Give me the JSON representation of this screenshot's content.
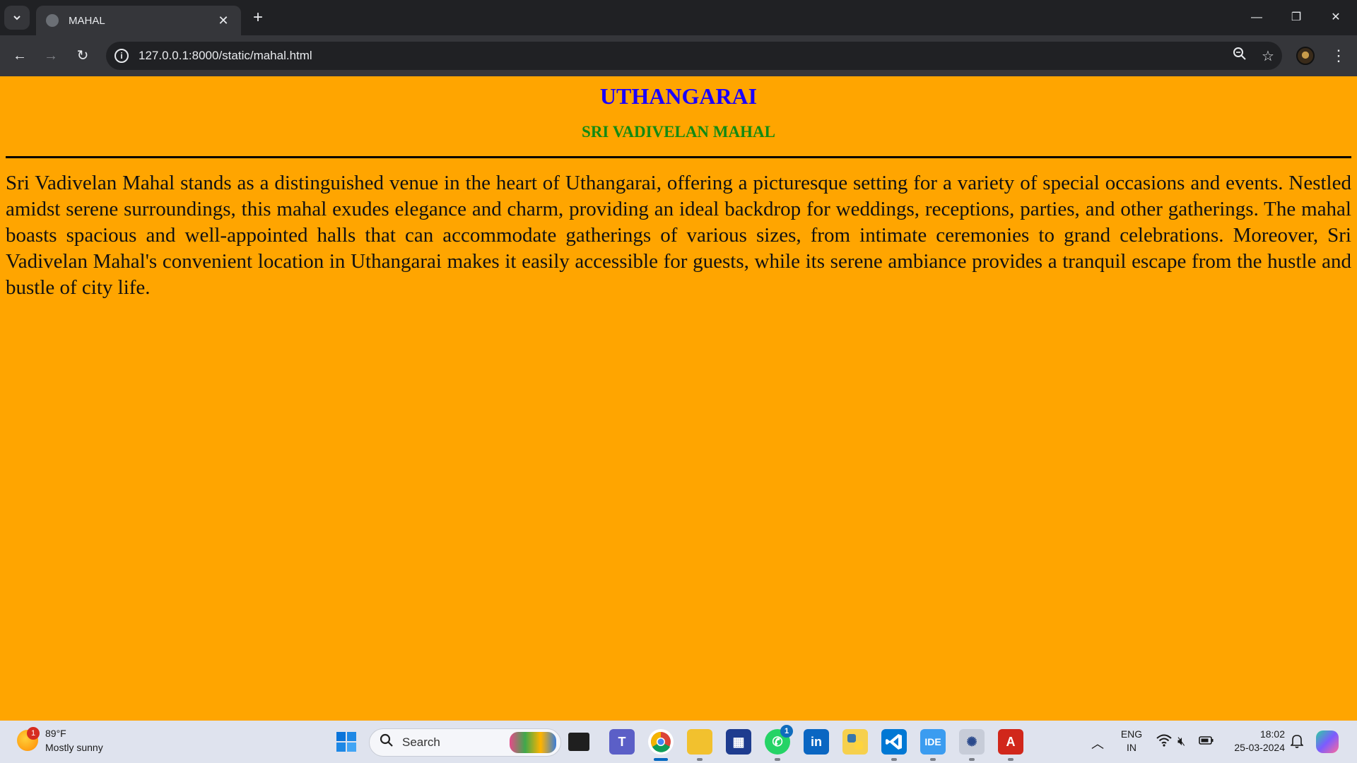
{
  "browser": {
    "tab_title": "MAHAL",
    "tab_close": "✕",
    "new_tab": "+",
    "url": "127.0.0.1:8000/static/mahal.html",
    "window_controls": {
      "minimize": "—",
      "restore": "❐",
      "close": "✕"
    }
  },
  "page": {
    "heading": "UTHANGARAI",
    "subheading": "SRI VADIVELAN MAHAL",
    "paragraph": "Sri Vadivelan Mahal stands as a distinguished venue in the heart of Uthangarai, offering a picturesque setting for a variety of special occasions and events. Nestled amidst serene surroundings, this mahal exudes elegance and charm, providing an ideal backdrop for weddings, receptions, parties, and other gatherings. The mahal boasts spacious and well-appointed halls that can accommodate gatherings of various sizes, from intimate ceremonies to grand celebrations. Moreover, Sri Vadivelan Mahal's convenient location in Uthangarai makes it easily accessible for guests, while its serene ambiance provides a tranquil escape from the hustle and bustle of city life."
  },
  "taskbar": {
    "weather": {
      "temp": "89°F",
      "condition": "Mostly sunny",
      "badge": "1"
    },
    "search_label": "Search",
    "whatsapp_badge": "1",
    "ide_label": "IDE",
    "language": {
      "line1": "ENG",
      "line2": "IN"
    },
    "clock": {
      "time": "18:02",
      "date": "25-03-2024"
    }
  },
  "colors": {
    "page_background": "#ffa500",
    "heading": "#1a00ff",
    "subheading": "#138a13"
  }
}
